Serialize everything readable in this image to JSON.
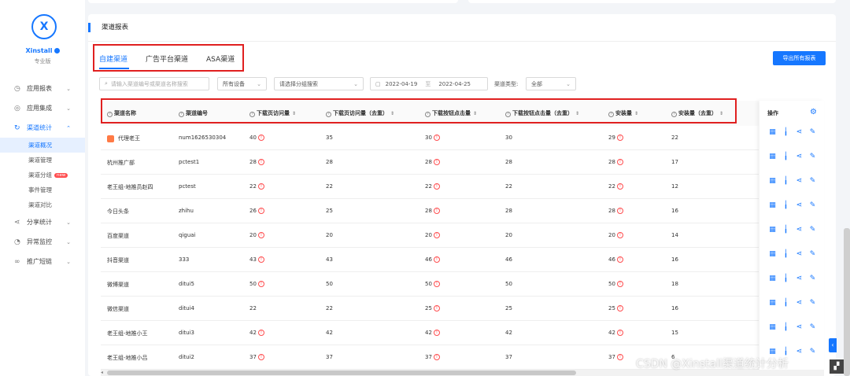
{
  "sidebar": {
    "logo_glyph": "X",
    "brand": "Xinstall",
    "edition": "专业版",
    "menu": [
      {
        "label": "应用报表",
        "icon": "chart-icon"
      },
      {
        "label": "应用集成",
        "icon": "integration-icon"
      },
      {
        "label": "渠道统计",
        "icon": "loop-icon"
      },
      {
        "label": "分享统计",
        "icon": "share-icon"
      },
      {
        "label": "异常监控",
        "icon": "monitor-icon"
      },
      {
        "label": "推广短链",
        "icon": "link-icon"
      }
    ],
    "submenu": [
      "渠道概况",
      "渠道管理",
      "渠道分组",
      "事件管理",
      "渠道对比"
    ],
    "new_badge": "new"
  },
  "card": {
    "title": "渠道报表",
    "tabs": [
      "自建渠道",
      "广告平台渠道",
      "ASA渠道"
    ],
    "export_label": "导出所有报表"
  },
  "filters": {
    "search_placeholder": "请输入渠道编号或渠道名称搜索",
    "device": "所有设备",
    "group_placeholder": "请选择分组搜索",
    "date_start": "2022-04-19",
    "date_sep": "至",
    "date_end": "2022-04-25",
    "type_label": "渠道类型:",
    "type_value": "全部"
  },
  "table": {
    "headers": [
      "渠道名称",
      "渠道编号",
      "下载页访问量",
      "下载页访问量（去重）",
      "下载按钮点击量",
      "下载按钮点击量（去重）",
      "安装量",
      "安装量（去重）"
    ],
    "ops_header": "操作",
    "rows": [
      {
        "name": "代理老王",
        "code": "num1626530304",
        "visits": "40",
        "visits_u": "35",
        "clicks": "30",
        "clicks_u": "30",
        "installs": "29",
        "installs_u": "22"
      },
      {
        "name": "杭州推广部",
        "code": "pctest1",
        "visits": "28",
        "visits_u": "28",
        "clicks": "28",
        "clicks_u": "28",
        "installs": "28",
        "installs_u": "17"
      },
      {
        "name": "老王组-地推员赵四",
        "code": "pctest",
        "visits": "22",
        "visits_u": "22",
        "clicks": "22",
        "clicks_u": "22",
        "installs": "22",
        "installs_u": "12"
      },
      {
        "name": "今日头条",
        "code": "zhihu",
        "visits": "26",
        "visits_u": "25",
        "clicks": "28",
        "clicks_u": "28",
        "installs": "28",
        "installs_u": "16"
      },
      {
        "name": "百度渠道",
        "code": "qiguai",
        "visits": "20",
        "visits_u": "20",
        "clicks": "20",
        "clicks_u": "20",
        "installs": "20",
        "installs_u": "14"
      },
      {
        "name": "抖音渠道",
        "code": "333",
        "visits": "43",
        "visits_u": "43",
        "clicks": "46",
        "clicks_u": "46",
        "installs": "46",
        "installs_u": "16"
      },
      {
        "name": "微博渠道",
        "code": "ditui5",
        "visits": "50",
        "visits_u": "50",
        "clicks": "50",
        "clicks_u": "50",
        "installs": "50",
        "installs_u": "18"
      },
      {
        "name": "微信渠道",
        "code": "ditui4",
        "visits": "22",
        "visits_u": "22",
        "clicks": "25",
        "clicks_u": "25",
        "installs": "25",
        "installs_u": "16"
      },
      {
        "name": "老王组-地推小王",
        "code": "ditui3",
        "visits": "42",
        "visits_u": "42",
        "clicks": "42",
        "clicks_u": "42",
        "installs": "42",
        "installs_u": "15"
      },
      {
        "name": "老王组-地推小吕",
        "code": "ditui2",
        "visits": "37",
        "visits_u": "37",
        "clicks": "37",
        "clicks_u": "37",
        "installs": "37",
        "installs_u": "6"
      }
    ]
  },
  "watermark": "CSDN @Xinstall渠道统计分析",
  "colors": {
    "accent": "#1677ff",
    "warn": "#ff4d4f",
    "highlight_box": "#e02020"
  }
}
